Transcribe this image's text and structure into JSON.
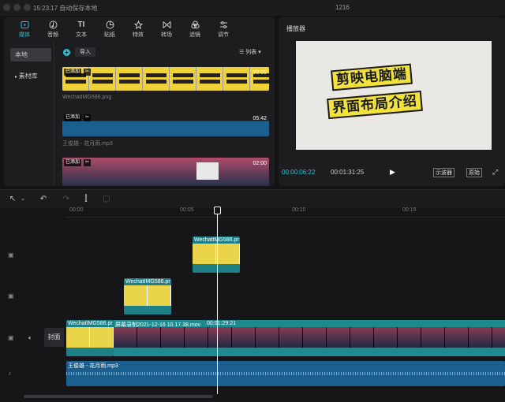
{
  "titlebar": {
    "left_text": "15:23:17 自动保存本地",
    "title": "1216"
  },
  "tabs": [
    {
      "label": "媒体",
      "icon": "media-icon"
    },
    {
      "label": "音频",
      "icon": "audio-icon"
    },
    {
      "label": "文本",
      "icon": "text-icon"
    },
    {
      "label": "贴纸",
      "icon": "sticker-icon"
    },
    {
      "label": "特效",
      "icon": "effects-icon"
    },
    {
      "label": "转场",
      "icon": "transition-icon"
    },
    {
      "label": "滤镜",
      "icon": "filter-icon"
    },
    {
      "label": "调节",
      "icon": "adjust-icon"
    }
  ],
  "side": {
    "local": "本地",
    "library": "素材库"
  },
  "media_toolbar": {
    "import": "导入",
    "view": "列表"
  },
  "assets": [
    {
      "name": "WechatIMG586.png",
      "badge": "已添加",
      "duration": "00:05"
    },
    {
      "name": "王俊雄 - 花月雨.mp3",
      "badge": "已添加",
      "duration": "05:42"
    },
    {
      "name": "屏幕录制2021-12-16 10.17.38.mov",
      "badge": "已添加",
      "duration": "02:00"
    }
  ],
  "player": {
    "title": "播放器",
    "current": "00:00:06:22",
    "total": "00:01:31:25",
    "scope_btn": "示波器",
    "original_btn": "原始",
    "frame_line1": "剪映电脑端",
    "frame_line2": "界面布局介绍"
  },
  "ruler": [
    "00:00",
    "00:05",
    "00:10",
    "00:15"
  ],
  "tracks": {
    "cover_label": "封面",
    "clip_top": "WechatIMG586.pr",
    "clip_mid": "WechatIMG586.pr",
    "main_clip1": "WechatIMG586.pr",
    "main_clip2": "屏幕录制2021-12-16 10.17.38.mov",
    "main_clip2_dur": "00:01:29:21",
    "audio_clip": "王俊雄 - 花月雨.mp3"
  },
  "colors": {
    "accent": "#20c3d7",
    "audio": "#1b5f8e",
    "main_track": "#1f8a8e"
  }
}
